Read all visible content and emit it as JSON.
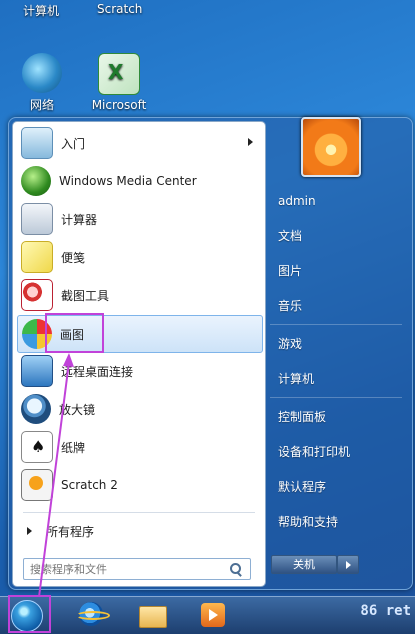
{
  "desktop": {
    "top_labels": [
      "计算机",
      "Scratch"
    ],
    "icons": [
      {
        "label": "网络",
        "icon": "network-globe-icon"
      },
      {
        "label": "Microsoft",
        "icon": "excel-icon"
      }
    ]
  },
  "start_menu": {
    "programs": [
      {
        "label": "入门",
        "icon": "getting-started-icon",
        "submenu": true
      },
      {
        "label": "Windows Media Center",
        "icon": "media-center-icon"
      },
      {
        "label": "计算器",
        "icon": "calculator-icon"
      },
      {
        "label": "便笺",
        "icon": "sticky-notes-icon"
      },
      {
        "label": "截图工具",
        "icon": "snipping-tool-icon"
      },
      {
        "label": "画图",
        "icon": "paint-icon",
        "selected": true
      },
      {
        "label": "远程桌面连接",
        "icon": "remote-desktop-icon"
      },
      {
        "label": "放大镜",
        "icon": "magnifier-icon"
      },
      {
        "label": "纸牌",
        "icon": "solitaire-icon"
      },
      {
        "label": "Scratch 2",
        "icon": "scratch-icon"
      }
    ],
    "all_programs": "所有程序",
    "search_placeholder": "搜索程序和文件",
    "right": {
      "user": "admin",
      "items": [
        "文档",
        "图片",
        "音乐",
        "游戏",
        "计算机",
        "控制面板",
        "设备和打印机",
        "默认程序",
        "帮助和支持"
      ]
    },
    "shutdown_label": "关机"
  },
  "taskbar": {
    "buttons": [
      "start-orb-icon",
      "internet-explorer-icon",
      "file-explorer-icon",
      "media-player-icon"
    ],
    "watermark": "86 ret"
  },
  "colors": {
    "accent_annotation": "#c142d9",
    "selection_bg": "#cde3f8",
    "desktop_bg": "#1f6fc1"
  }
}
